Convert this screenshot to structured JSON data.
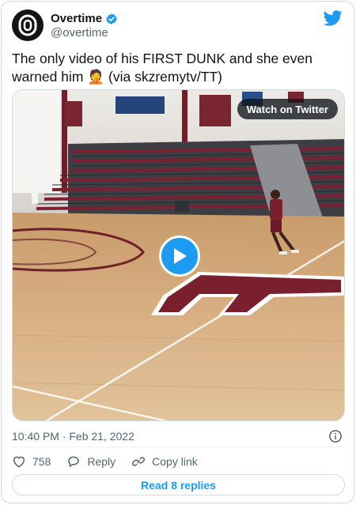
{
  "author": {
    "name": "Overtime",
    "handle": "@overtime",
    "verified": true
  },
  "tweet": {
    "text": "The only video of his FIRST DUNK and she even warned him",
    "emoji": "🤦",
    "source": "(via skzremytv/TT)"
  },
  "media": {
    "watch_label": "Watch on Twitter",
    "scene_icon": "basketball-court-video-thumbnail"
  },
  "meta": {
    "timestamp": "10:40 PM · Feb 21, 2022"
  },
  "actions": {
    "likes": "758",
    "reply_label": "Reply",
    "copy_link_label": "Copy link"
  },
  "read_replies_label": "Read 8 replies",
  "colors": {
    "accent": "#1d9bf0",
    "text_primary": "#0f1419",
    "text_secondary": "#536471",
    "border": "#cfd9de"
  }
}
